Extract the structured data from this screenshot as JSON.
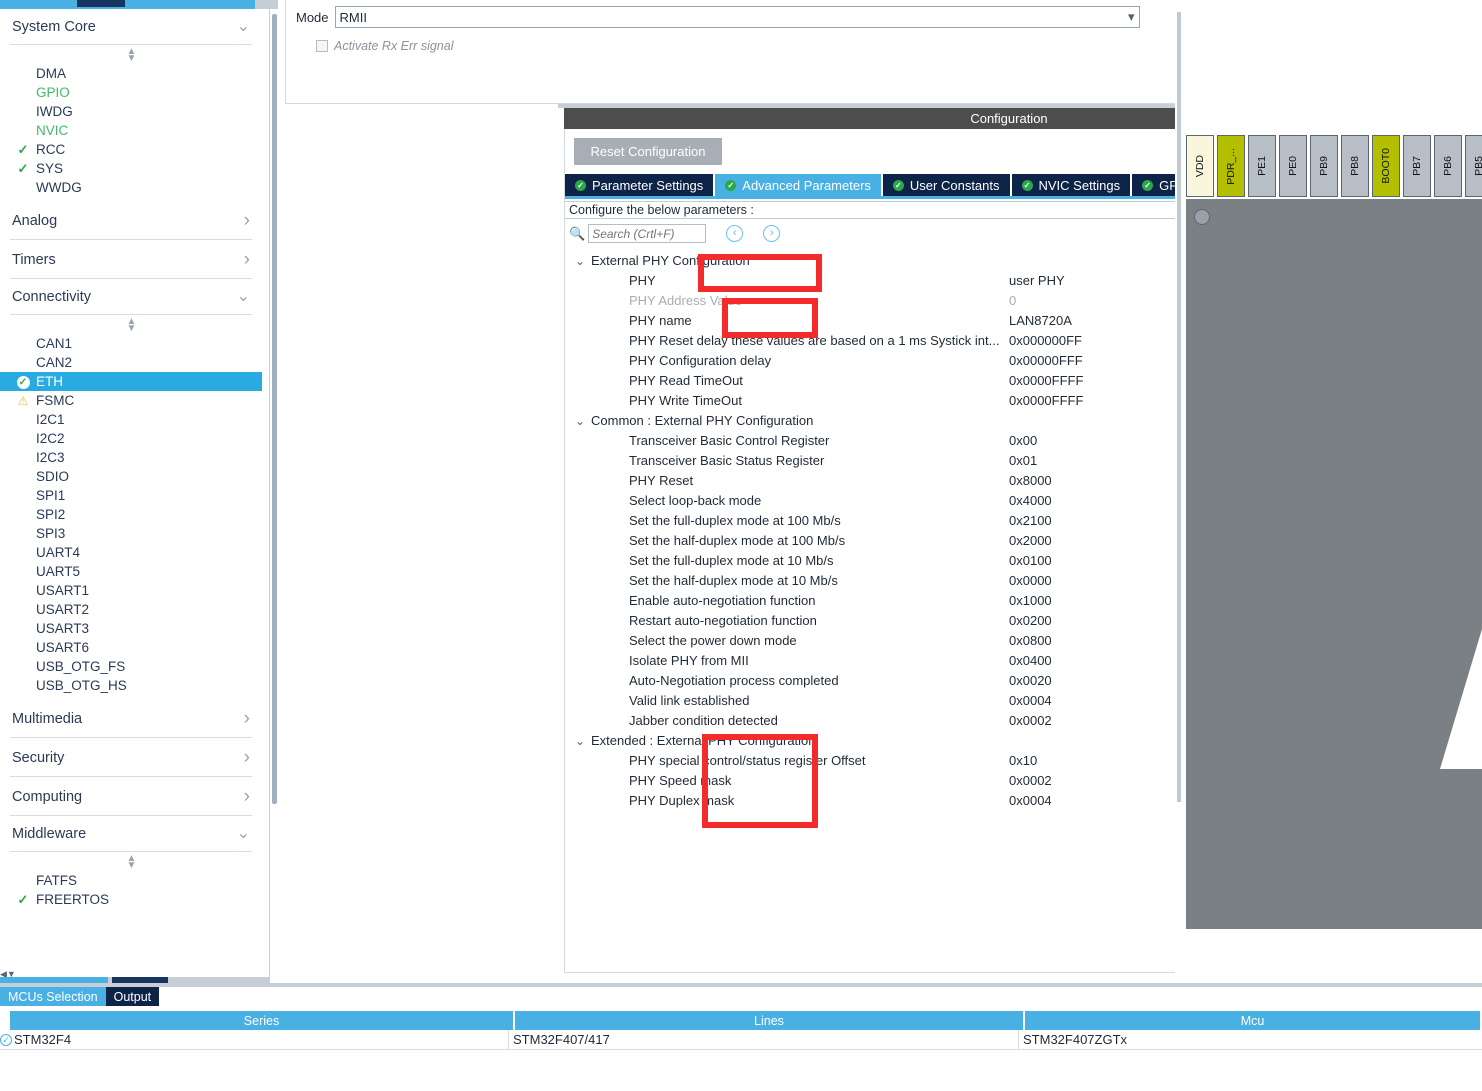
{
  "sidebar": {
    "groups": [
      {
        "label": "System Core",
        "expanded": true,
        "items": [
          {
            "label": "DMA",
            "state": "none"
          },
          {
            "label": "GPIO",
            "state": "green"
          },
          {
            "label": "IWDG",
            "state": "none"
          },
          {
            "label": "NVIC",
            "state": "green"
          },
          {
            "label": "RCC",
            "state": "check"
          },
          {
            "label": "SYS",
            "state": "check"
          },
          {
            "label": "WWDG",
            "state": "none"
          }
        ]
      },
      {
        "label": "Analog",
        "expanded": false,
        "items": []
      },
      {
        "label": "Timers",
        "expanded": false,
        "items": []
      },
      {
        "label": "Connectivity",
        "expanded": true,
        "items": [
          {
            "label": "CAN1",
            "state": "none"
          },
          {
            "label": "CAN2",
            "state": "none"
          },
          {
            "label": "ETH",
            "state": "selected"
          },
          {
            "label": "FSMC",
            "state": "warn"
          },
          {
            "label": "I2C1",
            "state": "none"
          },
          {
            "label": "I2C2",
            "state": "none"
          },
          {
            "label": "I2C3",
            "state": "none"
          },
          {
            "label": "SDIO",
            "state": "none"
          },
          {
            "label": "SPI1",
            "state": "none"
          },
          {
            "label": "SPI2",
            "state": "none"
          },
          {
            "label": "SPI3",
            "state": "none"
          },
          {
            "label": "UART4",
            "state": "none"
          },
          {
            "label": "UART5",
            "state": "none"
          },
          {
            "label": "USART1",
            "state": "none"
          },
          {
            "label": "USART2",
            "state": "none"
          },
          {
            "label": "USART3",
            "state": "none"
          },
          {
            "label": "USART6",
            "state": "none"
          },
          {
            "label": "USB_OTG_FS",
            "state": "none"
          },
          {
            "label": "USB_OTG_HS",
            "state": "none"
          }
        ]
      },
      {
        "label": "Multimedia",
        "expanded": false,
        "items": []
      },
      {
        "label": "Security",
        "expanded": false,
        "items": []
      },
      {
        "label": "Computing",
        "expanded": false,
        "items": []
      },
      {
        "label": "Middleware",
        "expanded": true,
        "items": [
          {
            "label": "FATFS",
            "state": "none"
          },
          {
            "label": "FREERTOS",
            "state": "check"
          }
        ]
      }
    ]
  },
  "mode_panel": {
    "mode_label": "Mode",
    "mode_value": "RMII",
    "rx_err_label": "Activate Rx Err signal",
    "rx_err_checked": false
  },
  "configuration": {
    "header": "Configuration",
    "reset_button": "Reset Configuration",
    "tabs": [
      {
        "label": "Parameter Settings",
        "active": false
      },
      {
        "label": "Advanced Parameters",
        "active": true
      },
      {
        "label": "User Constants",
        "active": false
      },
      {
        "label": "NVIC Settings",
        "active": false
      },
      {
        "label": "GPIO Settings",
        "active": false
      }
    ],
    "note": "Configure the below parameters :",
    "search_placeholder": "Search (Crtl+F)",
    "search_value": "",
    "prev_label": "‹",
    "next_label": "›",
    "info_label": "i",
    "groups": [
      {
        "label": "External PHY Configuration",
        "rows": [
          {
            "name": "PHY",
            "value": "user PHY",
            "dim": false
          },
          {
            "name": "PHY Address Value",
            "value": "0",
            "dim": true
          },
          {
            "name": "PHY name",
            "value": "LAN8720A",
            "dim": false
          },
          {
            "name": "PHY Reset delay these values are based on a 1 ms Systick int...",
            "value": "0x000000FF",
            "dim": false
          },
          {
            "name": "PHY Configuration delay",
            "value": "0x00000FFF",
            "dim": false
          },
          {
            "name": "PHY Read TimeOut",
            "value": "0x0000FFFF",
            "dim": false
          },
          {
            "name": "PHY Write TimeOut",
            "value": "0x0000FFFF",
            "dim": false
          }
        ]
      },
      {
        "label": "Common : External PHY Configuration",
        "rows": [
          {
            "name": "Transceiver Basic Control Register",
            "value": "0x00",
            "dim": false
          },
          {
            "name": "Transceiver Basic Status Register",
            "value": "0x01",
            "dim": false
          },
          {
            "name": "PHY Reset",
            "value": "0x8000",
            "dim": false
          },
          {
            "name": "Select loop-back mode",
            "value": "0x4000",
            "dim": false
          },
          {
            "name": "Set the full-duplex mode at 100 Mb/s",
            "value": "0x2100",
            "dim": false
          },
          {
            "name": "Set the half-duplex mode at 100 Mb/s",
            "value": "0x2000",
            "dim": false
          },
          {
            "name": "Set the full-duplex mode at 10 Mb/s",
            "value": "0x0100",
            "dim": false
          },
          {
            "name": "Set the half-duplex mode at 10 Mb/s",
            "value": "0x0000",
            "dim": false
          },
          {
            "name": "Enable auto-negotiation function",
            "value": "0x1000",
            "dim": false
          },
          {
            "name": "Restart auto-negotiation function",
            "value": "0x0200",
            "dim": false
          },
          {
            "name": "Select the power down mode",
            "value": "0x0800",
            "dim": false
          },
          {
            "name": "Isolate PHY from MII",
            "value": "0x0400",
            "dim": false
          },
          {
            "name": "Auto-Negotiation process completed",
            "value": "0x0020",
            "dim": false
          },
          {
            "name": "Valid link established",
            "value": "0x0004",
            "dim": false
          },
          {
            "name": "Jabber condition detected",
            "value": "0x0002",
            "dim": false
          }
        ]
      },
      {
        "label": "Extended : External PHY Configuration",
        "rows": [
          {
            "name": "PHY special control/status register Offset",
            "value": "0x10",
            "dim": false
          },
          {
            "name": "PHY Speed mask",
            "value": "0x0002",
            "dim": false
          },
          {
            "name": "PHY Duplex mask",
            "value": "0x0004",
            "dim": false
          }
        ]
      }
    ],
    "annotation_color": "#f42b2b"
  },
  "chip": {
    "pins": [
      {
        "label": "VDD",
        "kind": "vdd"
      },
      {
        "label": "PDR_...",
        "kind": "boot"
      },
      {
        "label": "PE1",
        "kind": "normal"
      },
      {
        "label": "PE0",
        "kind": "normal"
      },
      {
        "label": "PB9",
        "kind": "normal"
      },
      {
        "label": "PB8",
        "kind": "normal"
      },
      {
        "label": "BOOT0",
        "kind": "boot"
      },
      {
        "label": "PB7",
        "kind": "normal"
      },
      {
        "label": "PB6",
        "kind": "normal"
      },
      {
        "label": "PB5",
        "kind": "normal"
      }
    ]
  },
  "bottom": {
    "tabs": [
      {
        "label": "MCUs Selection",
        "active": true
      },
      {
        "label": "Output",
        "active": false
      }
    ],
    "columns": [
      "Series",
      "Lines",
      "Mcu"
    ],
    "rows": [
      {
        "series": "STM32F4",
        "lines": "STM32F407/417",
        "mcu": "STM32F407ZGTx"
      }
    ]
  }
}
